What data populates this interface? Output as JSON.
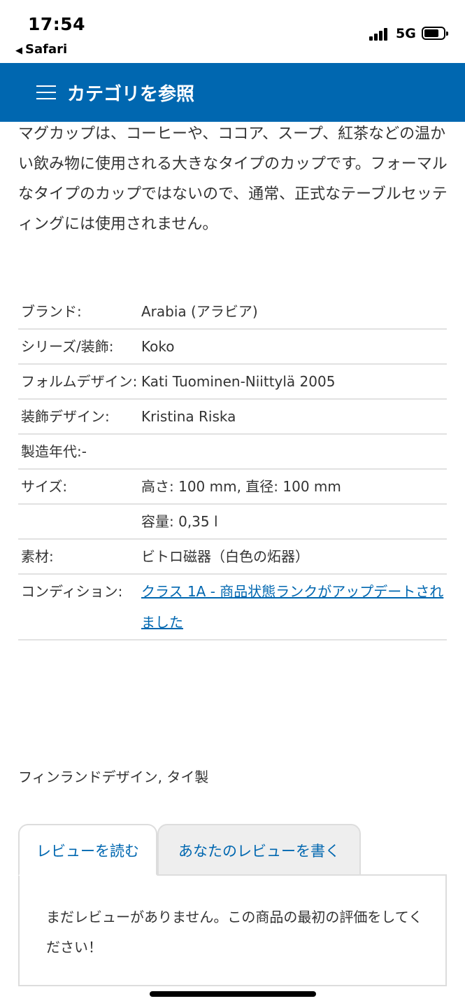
{
  "status_bar": {
    "time": "17:54",
    "back_app": "Safari",
    "network": "5G"
  },
  "nav": {
    "title": "カテゴリを参照",
    "menu_icon": "hamburger-icon"
  },
  "description": "マグカップは、コーヒーや、ココア、スープ、紅茶などの温かい飲み物に使用される大きなタイプのカップです。フォーマルなタイプのカップではないので、通常、正式なテーブルセッティングには使用されません。",
  "specs": [
    {
      "label": "ブランド:",
      "value": "Arabia (アラビア)"
    },
    {
      "label": "シリーズ/装飾:",
      "value": "Koko"
    },
    {
      "label": "フォルムデザイン:",
      "value": "Kati Tuominen-Niittylä 2005"
    },
    {
      "label": "装飾デザイン:",
      "value": "Kristina Riska"
    },
    {
      "label": "製造年代:-",
      "value": ""
    },
    {
      "label": "サイズ:",
      "value": "高さ: 100 mm, 直径: 100 mm"
    },
    {
      "label": "",
      "value": "容量: 0,35 l"
    },
    {
      "label": "素材:",
      "value": "ビトロ磁器（白色の炻器）"
    },
    {
      "label": "コンディション:",
      "value": "クラス 1A - 商品状態ランクがアップデートされました"
    }
  ],
  "origin": "フィンランドデザイン, タイ製",
  "tabs": {
    "read": "レビューを読む",
    "write": "あなたのレビューを書く"
  },
  "review_message": "まだレビューがありません。この商品の最初の評価をしてください！",
  "colors": {
    "brand_blue": "#0067b0",
    "link": "#0067b0"
  }
}
